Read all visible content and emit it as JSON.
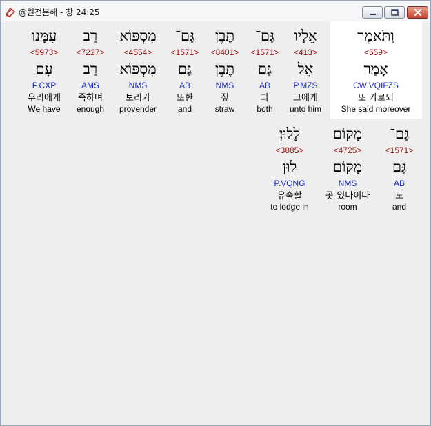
{
  "window": {
    "title": "@원전분해 - 창 24:25",
    "controls": [
      "minimize-button",
      "maximize-button",
      "close-button"
    ]
  },
  "lines": [
    {
      "words": [
        {
          "hebrew": "וַתֹּאמֶר",
          "strong": "<559>",
          "root": "אָמַר",
          "morph": "CW.VQIFZS",
          "korean": "또 가로되",
          "english": "She said moreover",
          "selected": true
        },
        {
          "hebrew": "אֵלָיו",
          "strong": "<413>",
          "root": "אֵל",
          "morph": "P.MZS",
          "korean": "그에게",
          "english": "unto him"
        },
        {
          "hebrew": "גַּם־",
          "strong": "<1571>",
          "root": "גַּם",
          "morph": "AB",
          "korean": "과",
          "english": "both"
        },
        {
          "hebrew": "תֶּבֶן",
          "strong": "<8401>",
          "root": "תֶּבֶן",
          "morph": "NMS",
          "korean": "짚",
          "english": "straw"
        },
        {
          "hebrew": "גַּם־",
          "strong": "<1571>",
          "root": "גַּם",
          "morph": "AB",
          "korean": "또한",
          "english": "and"
        },
        {
          "hebrew": "מִסְפּוֹא",
          "strong": "<4554>",
          "root": "מִסְפּוֹא",
          "morph": "NMS",
          "korean": "보리가",
          "english": "provender"
        },
        {
          "hebrew": "רַב",
          "strong": "<7227>",
          "root": "רַב",
          "morph": "AMS",
          "korean": "족하며",
          "english": "enough"
        },
        {
          "hebrew": "עִמָּנוּ",
          "strong": "<5973>",
          "root": "עִם",
          "morph": "P.CXP",
          "korean": "우리에게",
          "english": "We have"
        }
      ]
    },
    {
      "words": [
        {
          "hebrew": "גַּם־",
          "strong": "<1571>",
          "root": "גַּם",
          "morph": "AB",
          "korean": "도",
          "english": "and"
        },
        {
          "hebrew": "מָקוֹם",
          "strong": "<4725>",
          "root": "מָקוֹם",
          "morph": "NMS",
          "korean": "곳-있나이다",
          "english": "room"
        },
        {
          "hebrew": "לָלוּן׃",
          "strong": "<3885>",
          "root": "לוּן",
          "morph": "P.VQNG",
          "korean": "유숙할",
          "english": "to lodge in"
        }
      ]
    }
  ]
}
